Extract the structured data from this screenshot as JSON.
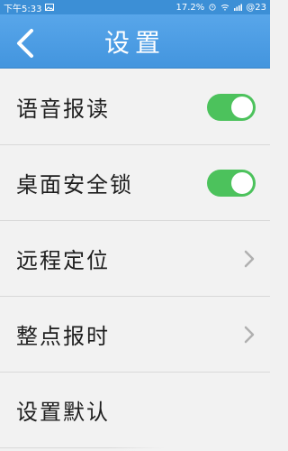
{
  "statusbar": {
    "time": "下午5:33",
    "battery": "17.2%",
    "carrier_right": "@23"
  },
  "appbar": {
    "title": "设置"
  },
  "settings": [
    {
      "label": "语音报读",
      "type": "toggle",
      "on": true
    },
    {
      "label": "桌面安全锁",
      "type": "toggle",
      "on": true
    },
    {
      "label": "远程定位",
      "type": "nav"
    },
    {
      "label": "整点报时",
      "type": "nav"
    },
    {
      "label": "设置默认",
      "type": "nav"
    }
  ],
  "colors": {
    "appbar": "#4b9be2",
    "toggle_on": "#4cc25c",
    "background": "#f2f2f2"
  }
}
